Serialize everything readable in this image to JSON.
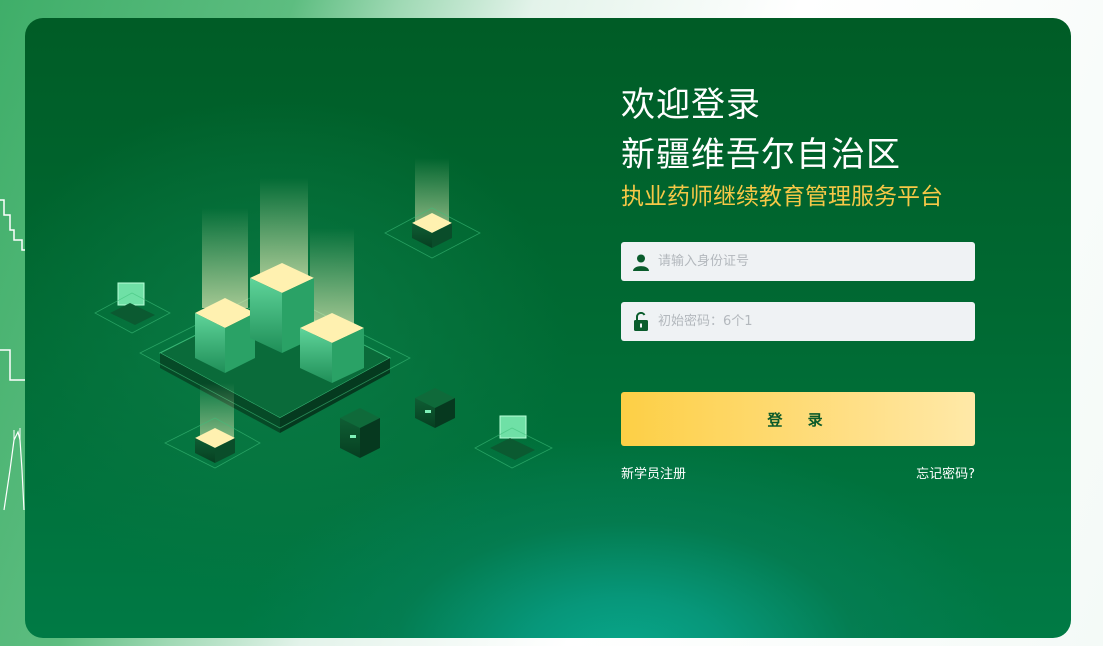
{
  "login": {
    "welcome": "欢迎登录",
    "region": "新疆维吾尔自治区",
    "platform": "执业药师继续教育管理服务平台",
    "id_placeholder": "请输入身份证号",
    "password_placeholder": "初始密码：6个1",
    "submit_label": "登 录",
    "register_link": "新学员注册",
    "forgot_link": "忘记密码?"
  },
  "icons": {
    "id_field": "user-icon",
    "password_field": "lock-icon"
  },
  "colors": {
    "card_green": "#005c26",
    "accent_yellow": "#f6c847",
    "button_yellow": "#fdcf45",
    "input_bg": "#eff2f4"
  }
}
